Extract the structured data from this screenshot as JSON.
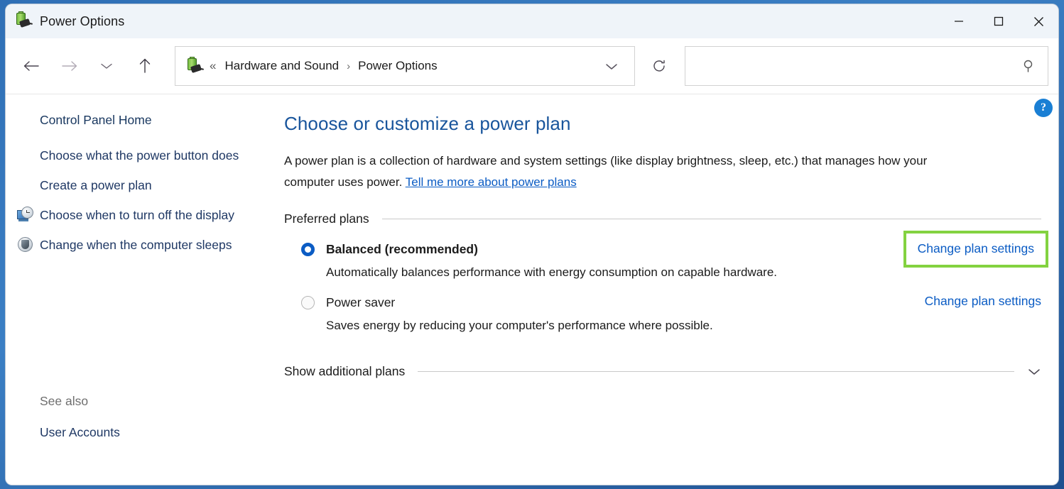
{
  "window": {
    "title": "Power Options",
    "icon": "power-plan-battery-plug-icon",
    "controls": {
      "minimize": "Minimize",
      "maximize": "Maximize",
      "close": "Close"
    }
  },
  "toolbar": {
    "back": "Back",
    "forward": "Forward",
    "recent": "Recent locations",
    "up": "Up one level",
    "refresh": "Refresh",
    "breadcrumb": {
      "overflow": "«",
      "separator": "›",
      "items": [
        {
          "label": "Hardware and Sound"
        },
        {
          "label": "Power Options"
        }
      ]
    },
    "address_chevron": "Previous locations",
    "search": {
      "value": "",
      "placeholder": "",
      "icon": "search-icon"
    }
  },
  "sidebar": {
    "items": [
      {
        "label": "Control Panel Home",
        "icon": null
      },
      {
        "label": "Choose what the power button does",
        "icon": null
      },
      {
        "label": "Create a power plan",
        "icon": null
      },
      {
        "label": "Choose when to turn off the display",
        "icon": "monitor-clock-icon"
      },
      {
        "label": "Change when the computer sleeps",
        "icon": "shield-icon"
      }
    ],
    "see_also_label": "See also",
    "see_also_items": [
      {
        "label": "User Accounts"
      }
    ]
  },
  "main": {
    "page_title": "Choose or customize a power plan",
    "intro_text_1": "A power plan is a collection of hardware and system settings (like display brightness, sleep, etc.) that manages how your computer uses power. ",
    "intro_link": "Tell me more about power plans",
    "preferred_plans_label": "Preferred plans",
    "plans": [
      {
        "name": "Balanced (recommended)",
        "description": "Automatically balances performance with energy consumption on capable hardware.",
        "action_label": "Change plan settings",
        "selected": true,
        "bold": true,
        "highlighted": true
      },
      {
        "name": "Power saver",
        "description": "Saves energy by reducing your computer's performance where possible.",
        "action_label": "Change plan settings",
        "selected": false,
        "bold": false,
        "highlighted": false
      }
    ],
    "show_additional_plans_label": "Show additional plans",
    "help_label": "?"
  },
  "colors": {
    "titlebar_bg": "#eff4f9",
    "link_blue": "#1f3864",
    "heading_blue": "#19559c",
    "action_link_blue": "#0b5cc4",
    "highlight_green": "#83d240",
    "radio_blue": "#0b5cc4",
    "help_blue": "#1a7fd4"
  }
}
